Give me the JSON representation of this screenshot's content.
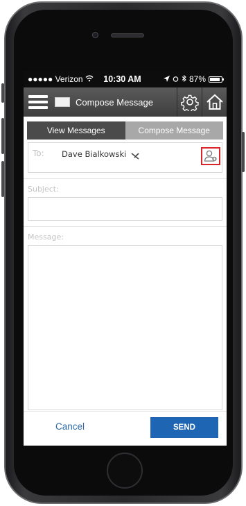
{
  "status_bar": {
    "carrier": "●●●●● Verizon",
    "time": "10:30 AM",
    "battery": "87%"
  },
  "header": {
    "title": "Compose Message",
    "icons": [
      "menu-icon",
      "logo",
      "settings-gear-icon",
      "home-icon"
    ]
  },
  "tabs": [
    {
      "label": "View Messages"
    },
    {
      "label": "Compose Message"
    }
  ],
  "compose": {
    "to_label": "To:",
    "recipient": "Dave Bialkowski",
    "subject_label": "Subject:",
    "subject_value": "",
    "message_label": "Message:",
    "message_value": ""
  },
  "footer": {
    "cancel_label": "Cancel",
    "send_label": "SEND"
  },
  "colors": {
    "accent_blue": "#1e66b4",
    "highlight_red": "#d9252a",
    "header_gray": "#4b4b4b"
  }
}
